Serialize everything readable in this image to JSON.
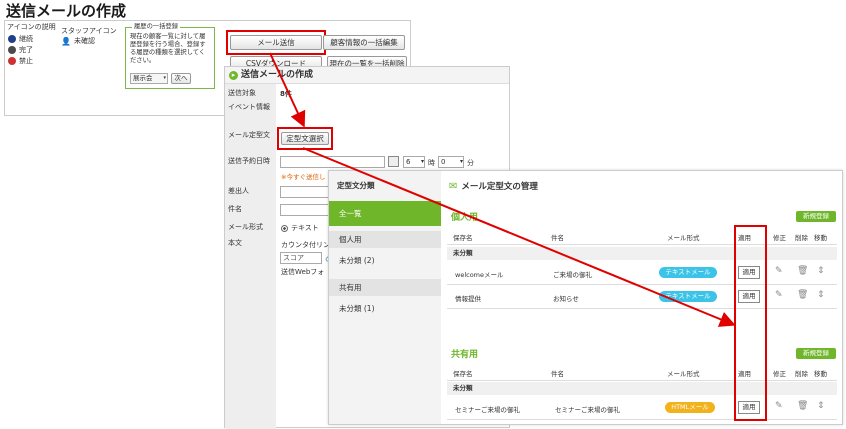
{
  "page_title": "送信メールの作成",
  "panel1": {
    "icon_legend_title": "アイコンの説明",
    "legend": [
      {
        "label": "継続",
        "color": "#1e3f8a"
      },
      {
        "label": "完了",
        "color": "#4a4a4a"
      },
      {
        "label": "禁止",
        "color": "#d03030"
      }
    ],
    "staff_icon_title": "スタッフアイコン",
    "staff_label": "未確認",
    "bulk_title": "履歴の一括登録",
    "bulk_text": "現在の顧客一覧に対して履歴登録を行う場合、登録する履歴の種類を選択してください。",
    "bulk_select": "展示会",
    "bulk_next": "次へ",
    "send_mail": "メール送信",
    "bulk_edit": "顧客情報の一括編集",
    "csv_download": "CSVダウンロード",
    "delete_list": "現在の一覧を一括削除"
  },
  "panel2": {
    "header": "送信メールの作成",
    "labels": {
      "target": "送信対象",
      "event": "イベント情報",
      "template": "メール定型文",
      "schedule": "送信予約日時",
      "sender": "差出人",
      "subject": "件名",
      "format": "メール形式",
      "body": "本文"
    },
    "target_value": "8件",
    "template_button": "定型文選択",
    "hour": "6",
    "hour_unit": "時",
    "minute": "0",
    "minute_unit": "分",
    "send_now": "※今すぐ送信し",
    "format_text": "テキスト",
    "body_hint": "カウンタ付リン",
    "score_value": "スコア",
    "web_hint": "送信Webフォ"
  },
  "panel3": {
    "sidebar_title": "定型文分類",
    "sidebar": [
      {
        "label": "全一覧",
        "active": true,
        "group": false
      },
      {
        "label": "個人用",
        "active": false,
        "group": true
      },
      {
        "label": "未分類 (2)",
        "active": false,
        "group": false
      },
      {
        "label": "共有用",
        "active": false,
        "group": true
      },
      {
        "label": "未分類 (1)",
        "active": false,
        "group": false
      }
    ],
    "header": "メール定型文の管理",
    "new_button": "新規登録",
    "personal_title": "個人用",
    "shared_title": "共有用",
    "columns": {
      "name": "保存名",
      "subject": "件名",
      "format": "メール形式",
      "apply": "適用",
      "edit": "修正",
      "delete": "削除",
      "move": "移動"
    },
    "uncategorized": "未分類",
    "personal_rows": [
      {
        "name": "welcomeメール",
        "subject": "ご来場の御礼",
        "format": "テキストメール",
        "apply": "適用"
      },
      {
        "name": "情報提供",
        "subject": "お知らせ",
        "format": "テキストメール",
        "apply": "適用"
      }
    ],
    "shared_rows": [
      {
        "name": "セミナーご来場の御礼",
        "subject": "セミナーご来場の御礼",
        "format": "HTMLメール",
        "apply": "適用"
      }
    ]
  },
  "colors": {
    "accent_green": "#6fb62b",
    "highlight_red": "#e00000",
    "text_pill": "#3cc4e8",
    "html_pill": "#f2b21b"
  }
}
